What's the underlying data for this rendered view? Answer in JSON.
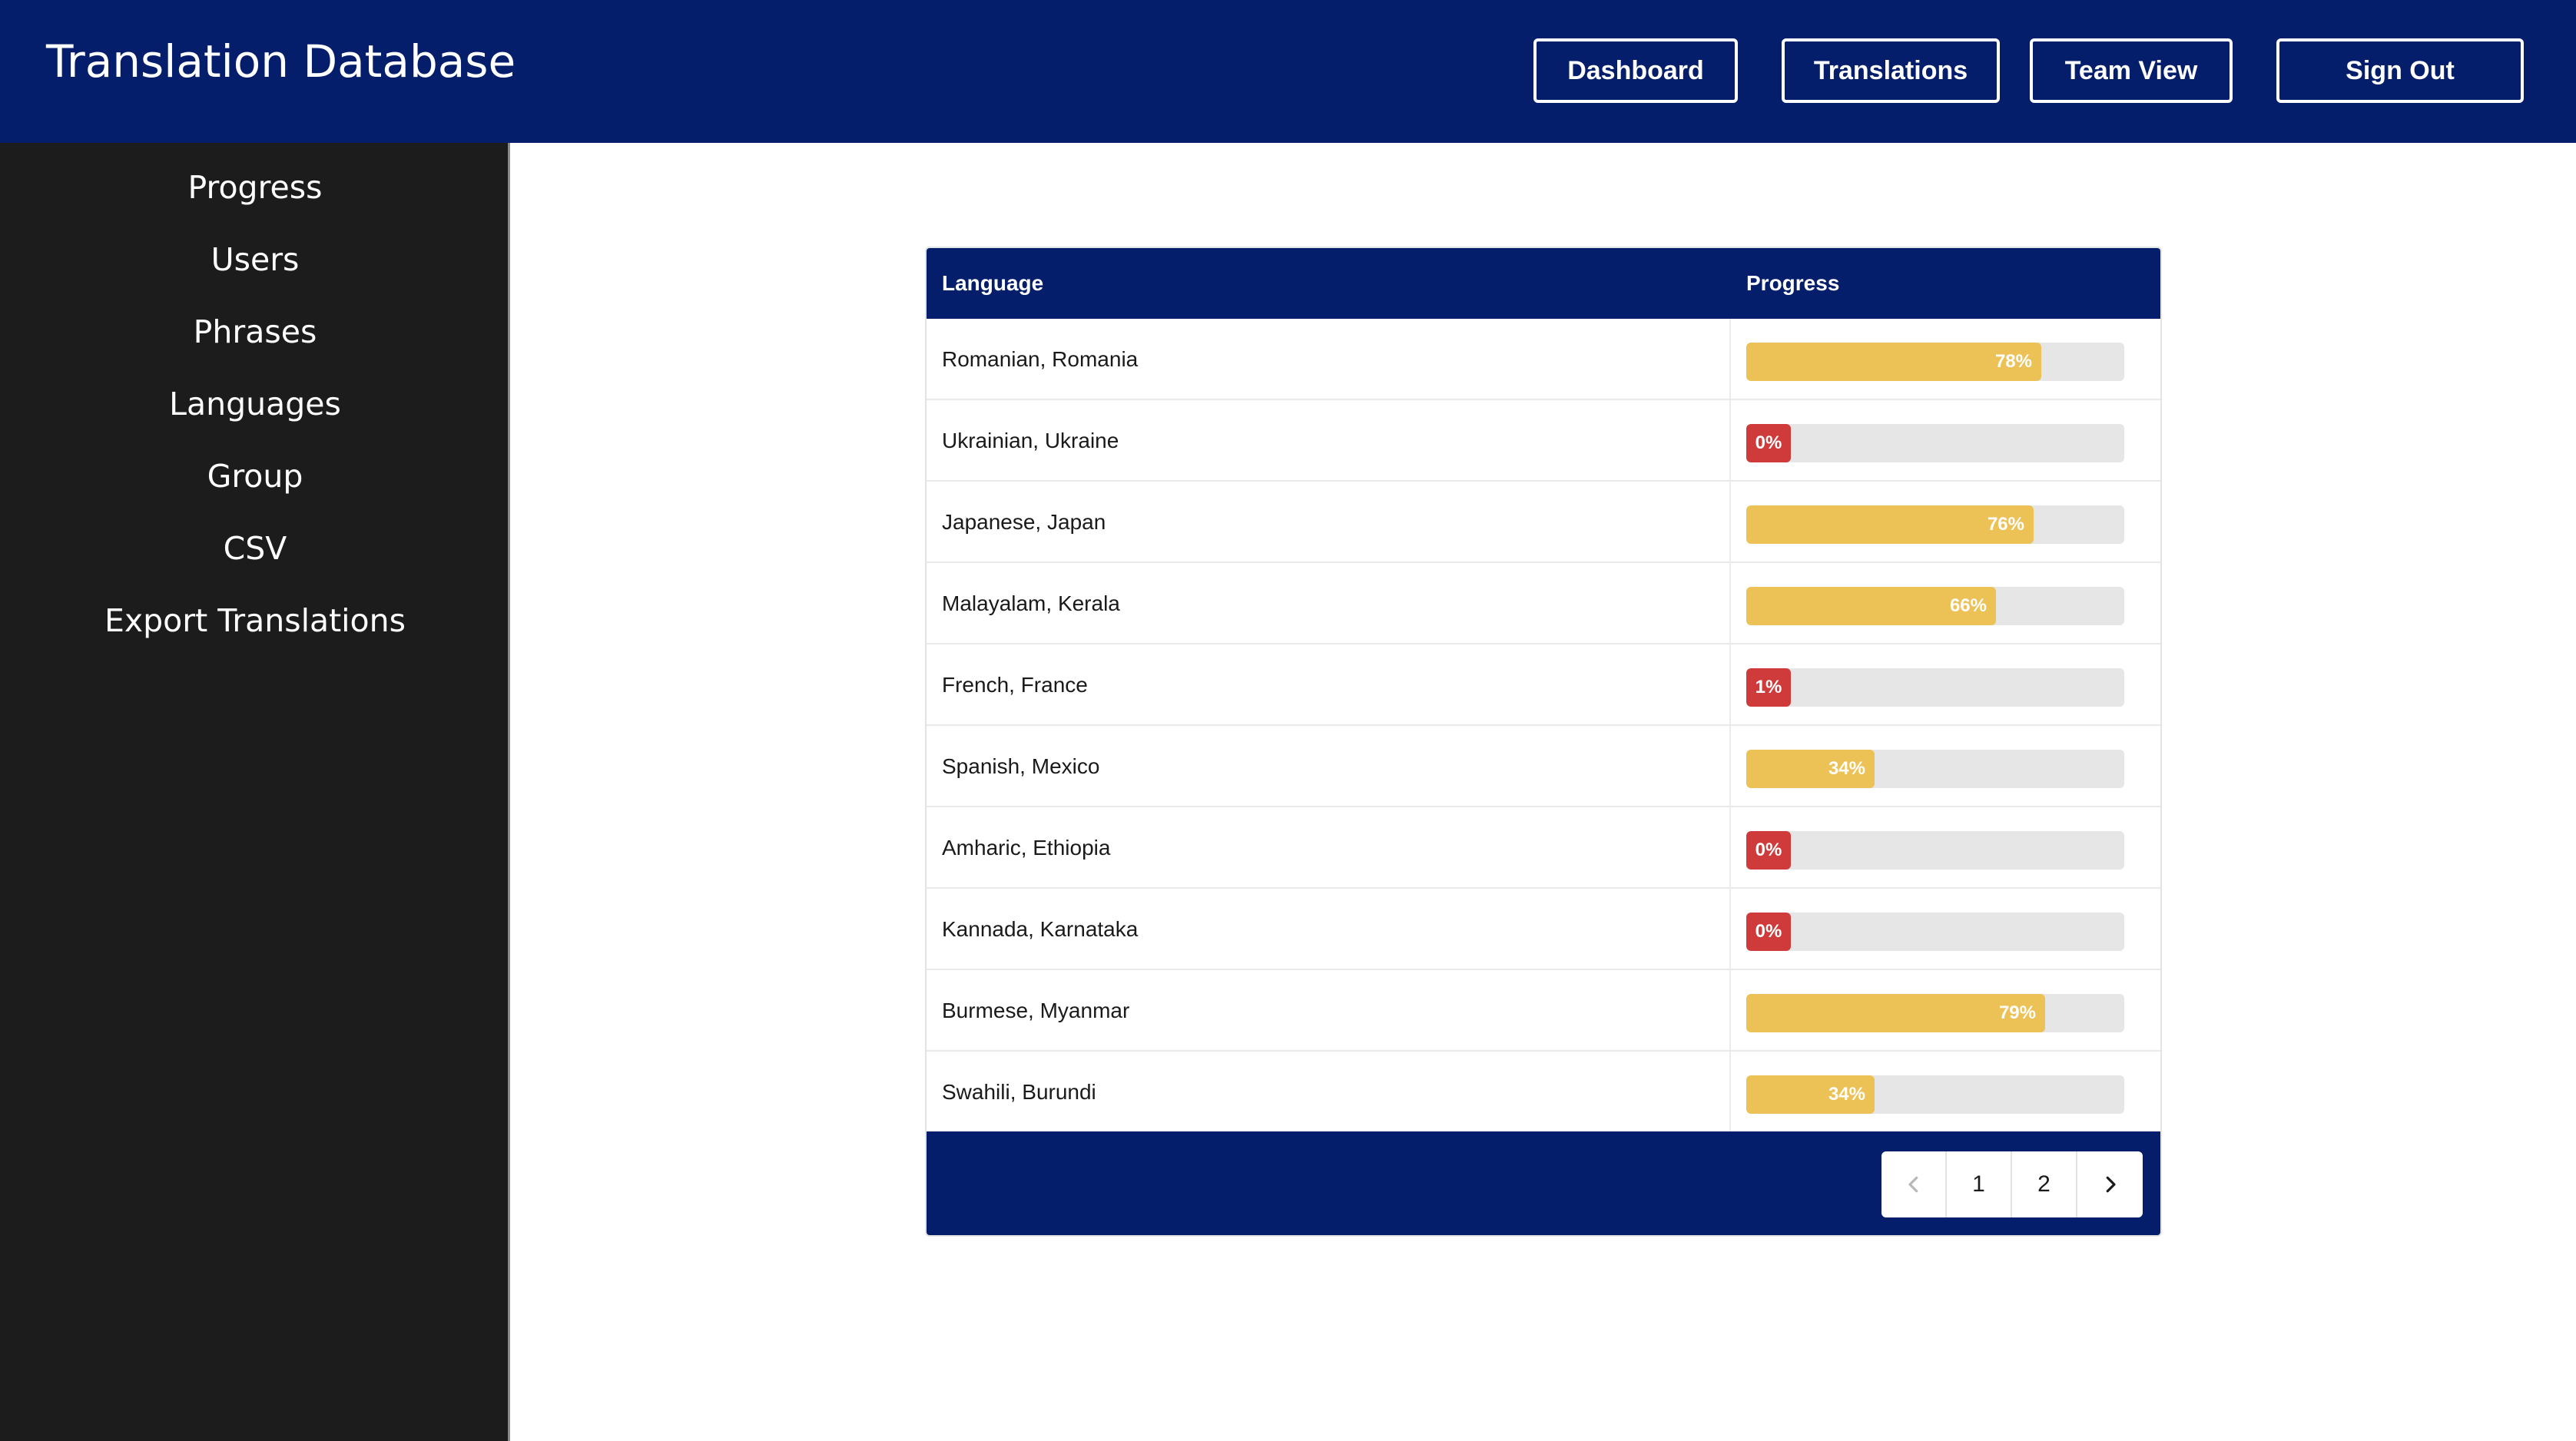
{
  "header": {
    "title": "Translation Database",
    "nav": [
      "Dashboard",
      "Translations",
      "Team View",
      "Sign Out"
    ]
  },
  "sidebar": {
    "items": [
      "Progress",
      "Users",
      "Phrases",
      "Languages",
      "Group",
      "CSV",
      "Export Translations"
    ]
  },
  "table": {
    "columns": [
      "Language",
      "Progress"
    ],
    "rows": [
      {
        "language": "Romanian, Romania",
        "progress": 78,
        "label": "78%"
      },
      {
        "language": "Ukrainian, Ukraine",
        "progress": 0,
        "label": "0%"
      },
      {
        "language": "Japanese, Japan",
        "progress": 76,
        "label": "76%"
      },
      {
        "language": "Malayalam, Kerala",
        "progress": 66,
        "label": "66%"
      },
      {
        "language": "French, France",
        "progress": 1,
        "label": "1%"
      },
      {
        "language": "Spanish, Mexico",
        "progress": 34,
        "label": "34%"
      },
      {
        "language": "Amharic, Ethiopia",
        "progress": 0,
        "label": "0%"
      },
      {
        "language": "Kannada, Karnataka",
        "progress": 0,
        "label": "0%"
      },
      {
        "language": "Burmese, Myanmar",
        "progress": 79,
        "label": "79%"
      },
      {
        "language": "Swahili, Burundi",
        "progress": 34,
        "label": "34%"
      }
    ]
  },
  "pagination": {
    "pages": [
      "1",
      "2"
    ],
    "prev_icon": "chevron-left-icon",
    "next_icon": "chevron-right-icon"
  },
  "colors": {
    "header_bg": "#041e6b",
    "sidebar_bg": "#1c1c1c",
    "progress_high": "#ecc257",
    "progress_low": "#cf3a3a",
    "track": "#e6e6e6"
  }
}
